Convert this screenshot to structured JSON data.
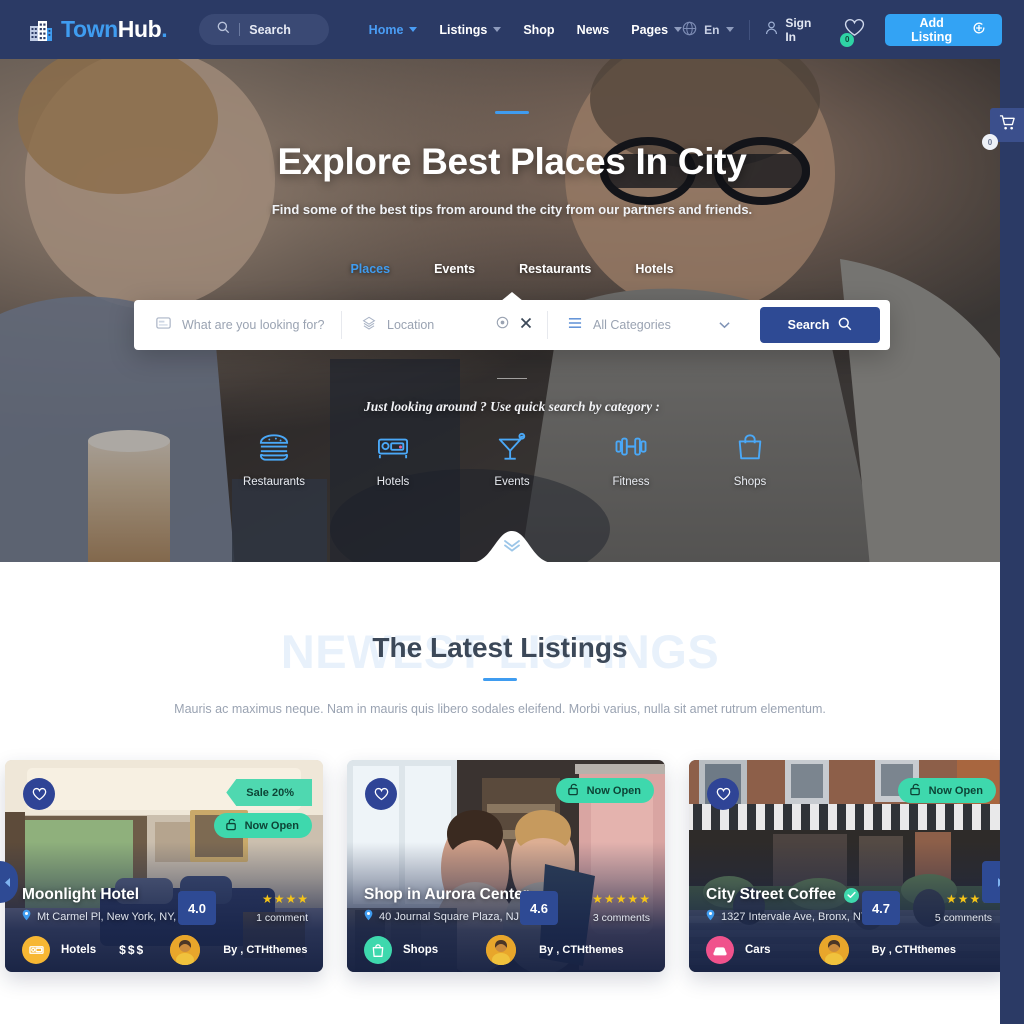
{
  "header": {
    "logo": {
      "part1": "Town",
      "part2": "Hub",
      "dot": ".",
      "icon": "building-icon"
    },
    "search": {
      "label": "Search",
      "icon": "search-icon"
    },
    "nav": [
      {
        "label": "Home",
        "has_caret": true,
        "active": true
      },
      {
        "label": "Listings",
        "has_caret": true,
        "active": false
      },
      {
        "label": "Shop",
        "has_caret": false,
        "active": false
      },
      {
        "label": "News",
        "has_caret": false,
        "active": false
      },
      {
        "label": "Pages",
        "has_caret": true,
        "active": false
      }
    ],
    "language": {
      "label": "En",
      "icon": "globe-icon"
    },
    "signin": {
      "label": "Sign In",
      "icon": "user-icon"
    },
    "wishlist": {
      "icon": "heart-icon",
      "count": "0"
    },
    "add_listing": {
      "label": "Add Listing",
      "icon": "plus-circle-icon"
    },
    "cart": {
      "icon": "cart-icon",
      "count": "0"
    }
  },
  "hero": {
    "title": "Explore Best Places In City",
    "subtitle": "Find some of the best tips from around the city from our partners and friends.",
    "tabs": [
      {
        "label": "Places",
        "active": true
      },
      {
        "label": "Events",
        "active": false
      },
      {
        "label": "Restaurants",
        "active": false
      },
      {
        "label": "Hotels",
        "active": false
      }
    ],
    "search_form": {
      "keyword": {
        "placeholder": "What are you looking for?",
        "value": "",
        "icon": "card-icon"
      },
      "location": {
        "placeholder": "Location",
        "value": "",
        "icon": "compass-icon",
        "locate_icon": "target-icon",
        "clear_icon": "close-icon"
      },
      "category": {
        "placeholder": "All Categories",
        "value": "All Categories",
        "icon": "list-icon",
        "caret_icon": "chevron-down-icon"
      },
      "submit": {
        "label": "Search",
        "icon": "search-icon"
      }
    },
    "quick_label": "Just looking around ? Use quick search by category :",
    "quick_categories": [
      {
        "label": "Restaurants",
        "icon": "burger-icon"
      },
      {
        "label": "Hotels",
        "icon": "bed-icon"
      },
      {
        "label": "Events",
        "icon": "cocktail-icon"
      },
      {
        "label": "Fitness",
        "icon": "dumbbell-icon"
      },
      {
        "label": "Shops",
        "icon": "shopping-bag-icon"
      }
    ],
    "scroll_icon": "double-chevron-down-icon"
  },
  "listings": {
    "watermark": "NEWEST LISTINGS",
    "title": "The Latest Listings",
    "description": "Mauris ac maximus neque. Nam in mauris quis libero sodales eleifend. Morbi varius, nulla sit amet rutrum elementum.",
    "prev_label": "◀",
    "next_label": "▶",
    "cards": [
      {
        "title": "Moonlight Hotel",
        "verified": false,
        "address": "Mt Carmel Pl, New York, NY, USA",
        "rating": "4.0",
        "stars": 4,
        "comments": "1 comment",
        "category": "Hotels",
        "category_icon": "bed-icon",
        "category_color": "#f7b733",
        "price": "$$$",
        "author": "By , CTHthemes",
        "badges": [
          {
            "label": "Sale 20%",
            "type": "sale"
          },
          {
            "label": "Now Open",
            "type": "open",
            "icon": "unlock-icon"
          }
        ]
      },
      {
        "title": "Shop in Aurora Center",
        "verified": false,
        "address": "40 Journal Square Plaza, NJ, USA",
        "rating": "4.6",
        "stars": 5,
        "comments": "3 comments",
        "category": "Shops",
        "category_icon": "shopping-bag-icon",
        "category_color": "#3ed8ad",
        "price": "",
        "author": "By , CTHthemes",
        "badges": [
          {
            "label": "Now Open",
            "type": "open",
            "icon": "unlock-icon"
          }
        ]
      },
      {
        "title": "City Street Coffee",
        "verified": true,
        "address": "1327 Intervale Ave, Bronx, NY, USA",
        "rating": "4.7",
        "stars": 4,
        "comments": "5 comments",
        "category": "Cars",
        "category_icon": "car-icon",
        "category_color": "#f0528c",
        "price": "",
        "author": "By , CTHthemes",
        "badges": [
          {
            "label": "Now Open",
            "type": "open",
            "icon": "unlock-icon"
          }
        ]
      }
    ]
  },
  "colors": {
    "header_bg": "#2b3a65",
    "accent_blue": "#3f9cf0",
    "button_blue": "#33a3f4",
    "search_btn": "#2e4a94",
    "green": "#3ed8ad",
    "star": "#f5c418"
  }
}
